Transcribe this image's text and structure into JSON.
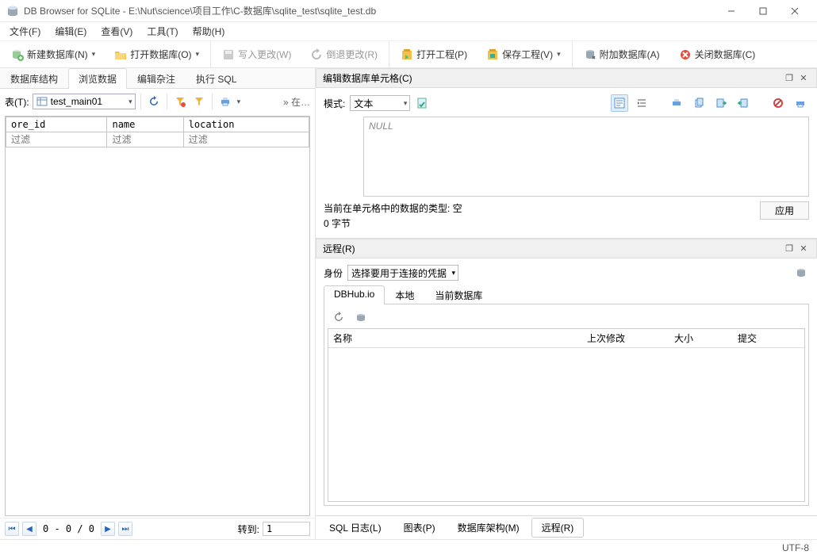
{
  "title": "DB Browser for SQLite - E:\\Nut\\science\\项目工作\\C-数据库\\sqlite_test\\sqlite_test.db",
  "menus": [
    "文件(F)",
    "编辑(E)",
    "查看(V)",
    "工具(T)",
    "帮助(H)"
  ],
  "toolbar": {
    "new_db": "新建数据库(N)",
    "open_db": "打开数据库(O)",
    "write_changes": "写入更改(W)",
    "revert_changes": "倒退更改(R)",
    "open_project": "打开工程(P)",
    "save_project": "保存工程(V)",
    "attach_db": "附加数据库(A)",
    "close_db": "关闭数据库(C)"
  },
  "left_tabs": [
    "数据库结构",
    "浏览数据",
    "编辑杂注",
    "执行 SQL"
  ],
  "left_tabs_active": 1,
  "table_label": "表(T):",
  "table_selected": "test_main01",
  "at_label": "» 在…",
  "columns": [
    "ore_id",
    "name",
    "location"
  ],
  "filter_placeholder": "过滤",
  "nav": {
    "counter": "0 - 0 / 0",
    "goto_label": "转到:",
    "goto_value": "1"
  },
  "cell_panel_title": "编辑数据库单元格(C)",
  "cell": {
    "mode_label": "模式:",
    "mode_value": "文本",
    "null_text": "NULL",
    "type_label": "当前在单元格中的数据的类型: 空",
    "size_label": "0 字节",
    "apply": "应用"
  },
  "remote_panel_title": "远程(R)",
  "remote": {
    "identity_label": "身份",
    "identity_value": "选择要用于连接的凭据",
    "tabs": [
      "DBHub.io",
      "本地",
      "当前数据库"
    ],
    "tabs_active": 0,
    "cols": {
      "name": "名称",
      "modified": "上次修改",
      "size": "大小",
      "commit": "提交"
    }
  },
  "bottom_tabs": [
    "SQL 日志(L)",
    "图表(P)",
    "数据库架构(M)",
    "远程(R)"
  ],
  "bottom_tabs_active": 3,
  "status": "UTF-8"
}
